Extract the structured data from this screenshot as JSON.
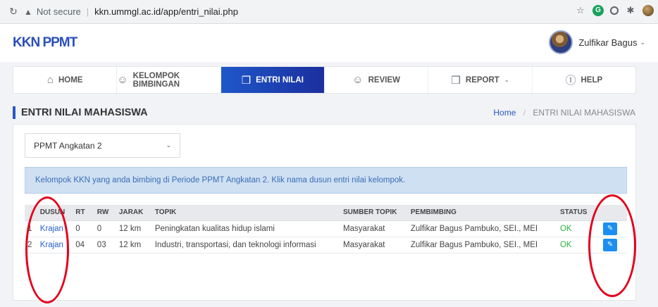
{
  "browser": {
    "reload_icon": "reload-icon",
    "security_label": "Not secure",
    "url": "kkn.ummgl.ac.id/app/entri_nilai.php"
  },
  "app": {
    "logo": "KKN PPMT",
    "user_name": "Zulfikar Bagus"
  },
  "nav": [
    {
      "label": "HOME",
      "icon": "home-icon",
      "glyph": "⌂"
    },
    {
      "label": "KELOMPOK BIMBINGAN",
      "icon": "smile-icon",
      "glyph": "☺"
    },
    {
      "label": "ENTRI NILAI",
      "icon": "book-icon",
      "glyph": "❒",
      "active": true
    },
    {
      "label": "REVIEW",
      "icon": "smile-icon",
      "glyph": "☺"
    },
    {
      "label": "REPORT",
      "icon": "book-icon",
      "glyph": "❒"
    },
    {
      "label": "HELP",
      "icon": "info-icon",
      "glyph": "ⓘ"
    }
  ],
  "page": {
    "title": "ENTRI NILAI MAHASISWA",
    "breadcrumb_home": "Home",
    "breadcrumb_current": "ENTRI NILAI MAHASISWA"
  },
  "period_select": {
    "selected": "PPMT Angkatan 2"
  },
  "alert": {
    "text": "Kelompok KKN yang anda bimbing di Periode PPMT Angkatan 2. Klik nama dusun entri nilai kelompok."
  },
  "table": {
    "headers": [
      "",
      "DUSUN",
      "RT",
      "RW",
      "JARAK",
      "TOPIK",
      "SUMBER TOPIK",
      "PEMBIMBING",
      "STATUS",
      ""
    ],
    "rows": [
      {
        "no": "1",
        "dusun": "Krajan",
        "rt": "0",
        "rw": "0",
        "jarak": "12 km",
        "topik": "Peningkatan kualitas hidup islami",
        "sumber": "Masyarakat",
        "pembimbing": "Zulfikar Bagus Pambuko, SEI., MEI",
        "status": "OK"
      },
      {
        "no": "2",
        "dusun": "Krajan",
        "rt": "04",
        "rw": "03",
        "jarak": "12 km",
        "topik": "Industri, transportasi, dan teknologi informasi",
        "sumber": "Masyarakat",
        "pembimbing": "Zulfikar Bagus Pambuko, SEI., MEI",
        "status": "OK"
      }
    ]
  },
  "colors": {
    "brand": "#2a4fb9",
    "nav_active": "#1e57c9",
    "status_ok": "#2fb344",
    "edit_button": "#1b8ff1",
    "annotation": "#e3001b"
  }
}
